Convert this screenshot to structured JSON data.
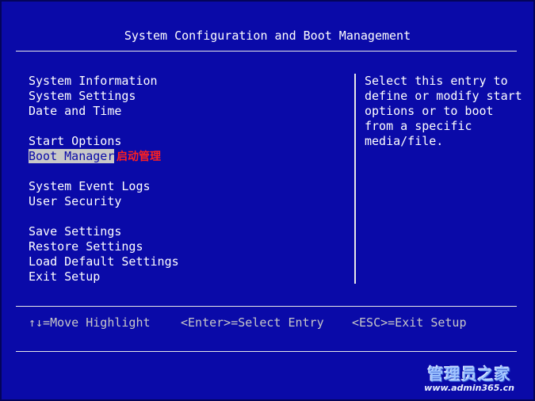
{
  "title": "System Configuration and Boot Management",
  "menu": {
    "items": [
      {
        "label": "System Information"
      },
      {
        "label": "System Settings"
      },
      {
        "label": "Date and Time"
      },
      {
        "label": "Start Options"
      },
      {
        "label": "Boot Manager",
        "selected": true
      },
      {
        "label": "System Event Logs"
      },
      {
        "label": "User Security"
      },
      {
        "label": "Save Settings"
      },
      {
        "label": "Restore Settings"
      },
      {
        "label": "Load Default Settings"
      },
      {
        "label": "Exit Setup"
      }
    ]
  },
  "annotation": "启动管理",
  "help": {
    "text": "Select this entry to\ndefine or modify start\noptions or to boot\nfrom a specific\nmedia/file."
  },
  "footer": {
    "move": "↑↓=Move Highlight",
    "select": "<Enter>=Select Entry",
    "exit": "<ESC>=Exit Setup"
  },
  "watermark": {
    "title": "管理员之家",
    "url": "www.admin365.cn"
  },
  "colors": {
    "background": "#0a0aa8",
    "highlight": "#c8c8c8",
    "annotation": "#ff2020"
  }
}
